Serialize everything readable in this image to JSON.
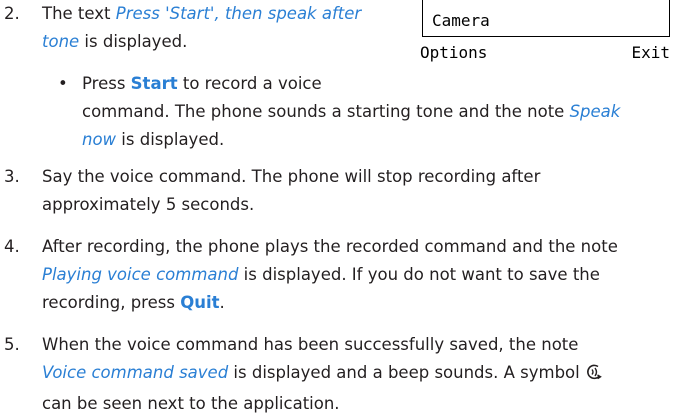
{
  "phone_screen": {
    "menu_item": "Camera",
    "left_softkey": "Options",
    "right_softkey": "Exit"
  },
  "steps": [
    {
      "number": "2.",
      "lines": [
        [
          "",
          "Press 'Start', then speak after"
        ],
        [
          "tone",
          " is displayed."
        ]
      ]
    },
    {
      "bullet": "•",
      "parts": {
        "press": "Press ",
        "start": "Start",
        "after_start": " to record a voice",
        "line2_pre": "command. The phone sounds a starting tone and the note ",
        "speak": "Speak",
        "now": "now",
        "line3_post": " is displayed."
      }
    },
    {
      "number": "3.",
      "line1": "Say the voice command. The phone will stop recording after",
      "line2": "approximately 5 seconds."
    },
    {
      "number": "4.",
      "line1": "After recording, the phone plays the recorded command and the note",
      "line2_em": "Playing voice command",
      "line2_post": " is displayed. If you do not want to save the",
      "line3_pre": "recording, press ",
      "line3_key": "Quit",
      "line3_post": "."
    },
    {
      "number": "5.",
      "line1": "When the voice command has been successfully saved, the note",
      "line2_em": "Voice command saved",
      "line2_post": " is displayed and a beep sounds. A symbol ",
      "line3": "can be seen next to the application."
    }
  ],
  "step2_em_line1": "Press 'Start', then speak after",
  "step2_em_line2": "tone",
  "step2_post": " is displayed.",
  "icon": "voice-tag-icon"
}
